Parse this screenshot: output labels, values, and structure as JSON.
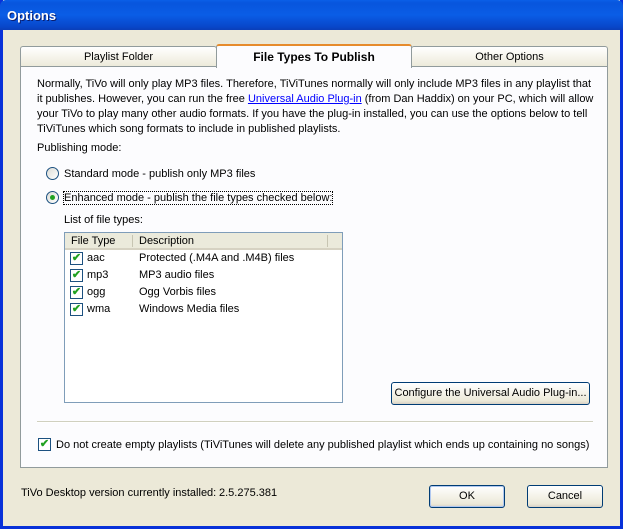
{
  "window": {
    "title": "Options"
  },
  "tabs": [
    {
      "label": "Playlist Folder"
    },
    {
      "label": "File Types To Publish"
    },
    {
      "label": "Other Options"
    }
  ],
  "intro": {
    "text_before": "Normally, TiVo will only play MP3 files. Therefore, TiViTunes normally will only include MP3 files in any playlist that it publishes. However, you can run the free ",
    "link": "Universal Audio Plug-in",
    "text_after": " (from Dan Haddix) on your PC, which will allow your TiVo to play many other audio formats. If you have the plug-in installed, you can use the options below to tell TiViTunes which song formats to include in published playlists."
  },
  "publishing_mode": {
    "label": "Publishing mode:",
    "standard": {
      "label": "Standard mode - publish only MP3 files",
      "selected": false
    },
    "enhanced": {
      "label": "Enhanced mode - publish the file types checked below:",
      "selected": true
    }
  },
  "file_types": {
    "label": "List of file types:",
    "columns": [
      "File Type",
      "Description"
    ],
    "rows": [
      {
        "type": "aac",
        "description": "Protected (.M4A and .M4B) files",
        "checked": true
      },
      {
        "type": "mp3",
        "description": "MP3 audio files",
        "checked": true
      },
      {
        "type": "ogg",
        "description": "Ogg Vorbis files",
        "checked": true
      },
      {
        "type": "wma",
        "description": "Windows Media files",
        "checked": true
      }
    ]
  },
  "configure_button": "Configure the Universal Audio Plug-in...",
  "empty_playlists": {
    "label": "Do not create empty playlists (TiViTunes will delete any published playlist which ends up containing no songs)",
    "checked": true
  },
  "footer": {
    "version_label": "TiVo Desktop version currently installed:",
    "version_value": "2.5.275.381",
    "ok": "OK",
    "cancel": "Cancel"
  }
}
